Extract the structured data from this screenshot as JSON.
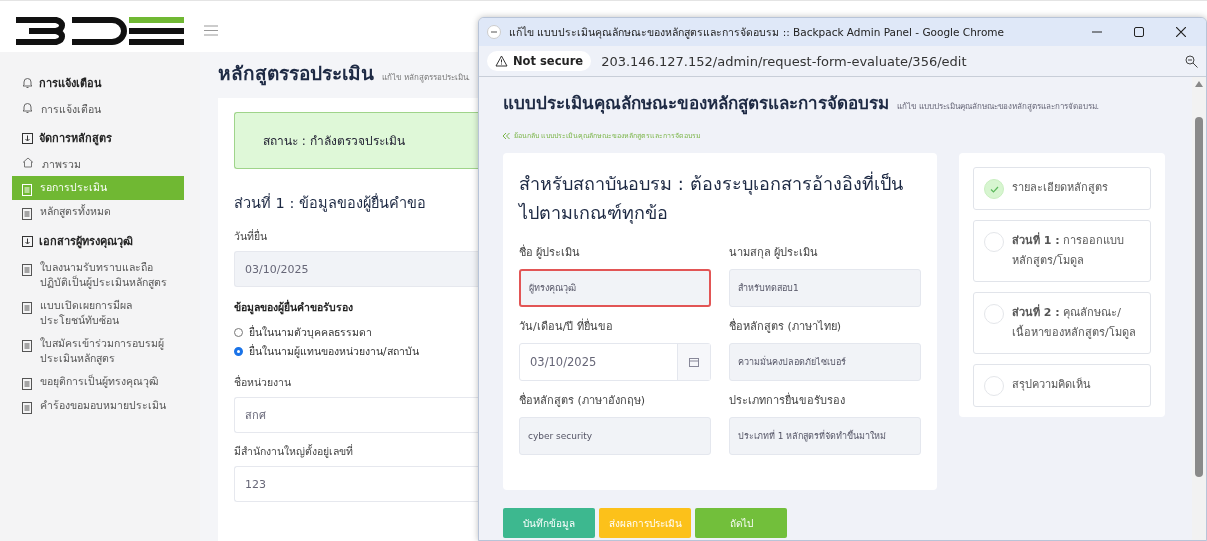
{
  "back_page": {
    "sidebar": [
      {
        "title": "การแจ้งเตือน",
        "items": [
          {
            "label": "การแจ้งเตือน",
            "selected": false
          }
        ]
      },
      {
        "title": "จัดการหลักสูตร",
        "items": [
          {
            "label": "ภาพรวม",
            "selected": false
          },
          {
            "label": "รอการประเมิน",
            "selected": true
          },
          {
            "label": "หลักสูตรทั้งหมด",
            "selected": false
          }
        ]
      },
      {
        "title": "เอกสารผู้ทรงคุณวุฒิ",
        "items": [
          {
            "label": "ใบลงนามรับทราบและถือปฏิบัติเป็นผู้ประเมินหลักสูตร",
            "selected": false
          },
          {
            "label": "แบบเปิดเผยการมีผลประโยชน์ทับซ้อน",
            "selected": false
          },
          {
            "label": "ใบสมัครเข้าร่วมการอบรมผู้ประเมินหลักสูตร",
            "selected": false
          },
          {
            "label": "ขอยุติการเป็นผู้ทรงคุณวุฒิ",
            "selected": false
          },
          {
            "label": "คำร้องขอมอบหมายประเมิน",
            "selected": false
          }
        ]
      }
    ],
    "page_title": "หลักสูตรรอประเมิน",
    "page_subtitle": "แก้ไข หลักสูตรรอประเมิน.",
    "status": "สถานะ : กำลังตรวจประเมิน",
    "section_title": "ส่วนที่ 1 : ข้อมูลของผู้ยื่นคำขอ",
    "date_label": "วันที่ยื่น",
    "date_value": "03/10/2025",
    "applicant_heading": "ข้อมูลของผู้ยื่นคำขอรับรอง",
    "radios": [
      {
        "label": "ยื่นในนามตัวบุคคลธรรมดา",
        "selected": false
      },
      {
        "label": "ยื่นในนามผู้แทนของหน่วยงาน/สถาบัน",
        "selected": true
      }
    ],
    "org_label": "ชื่อหน่วยงาน",
    "org_value": "สกศ",
    "hq_label": "มีสำนักงานใหญ่ตั้งอยู่เลขที่",
    "hq_value": "123"
  },
  "browser": {
    "title": "แก้ไข แบบประเมินคุณลักษณะของหลักสูตรและการจัดอบรม :: Backpack Admin Panel - Google Chrome",
    "security": "Not secure",
    "url": "203.146.127.152/admin/request-form-evaluate/356/edit",
    "page_title": "แบบประเมินคุณลักษณะของหลักสูตรและการจัดอบรม",
    "page_subtitle": "แก้ไข แบบประเมินคุณลักษณะของหลักสูตรและการจัดอบรม.",
    "back_link": "ย้อนกลับ แบบประเมินคุณลักษณะของหลักสูตรและการจัดอบรม",
    "form_heading": "สำหรับสถาบันอบรม : ต้องระบุเอกสารอ้างอิงที่เป็นไปตามเกณฑ์ทุกข้อ",
    "fields": [
      {
        "label": "ชื่อ ผู้ประเมิน",
        "value": "ผู้ทรงคุณวุฒิ",
        "kind": "text",
        "invalid": true
      },
      {
        "label": "นามสกุล ผู้ประเมิน",
        "value": "สำหรับทดสอบ1",
        "kind": "text",
        "invalid": false
      },
      {
        "label": "วัน/เดือน/ปี ที่ยื่นขอ",
        "value": "03/10/2025",
        "kind": "date",
        "invalid": false
      },
      {
        "label": "ชื่อหลักสูตร (ภาษาไทย)",
        "value": "ความมั่นคงปลอดภัยไซเบอร์",
        "kind": "text",
        "invalid": false
      },
      {
        "label": "ชื่อหลักสูตร (ภาษาอังกฤษ)",
        "value": "cyber security",
        "kind": "text",
        "invalid": false
      },
      {
        "label": "ประเภทการยื่นขอรับรอง",
        "value": "ประเภทที่ 1 หลักสูตรที่จัดทำขึ้นมาใหม่",
        "kind": "text",
        "invalid": false
      }
    ],
    "buttons": [
      {
        "label": "บันทึกข้อมูล",
        "kind": "save"
      },
      {
        "label": "ส่งผลการประเมิน",
        "kind": "submit"
      },
      {
        "label": "ถัดไป",
        "kind": "next"
      }
    ],
    "steps": [
      {
        "label": "รายละเอียดหลักสูตร",
        "done": true
      },
      {
        "label": "**ส่วนที่ 1 :** การออกแบบหลักสูตร/โมดูล",
        "done": false
      },
      {
        "label": "**ส่วนที่ 2 :** คุณลักษณะ/เนื้อหาของหลักสูตร/โมดูล",
        "done": false
      },
      {
        "label": "สรุปความคิดเห็น",
        "done": false
      }
    ]
  }
}
